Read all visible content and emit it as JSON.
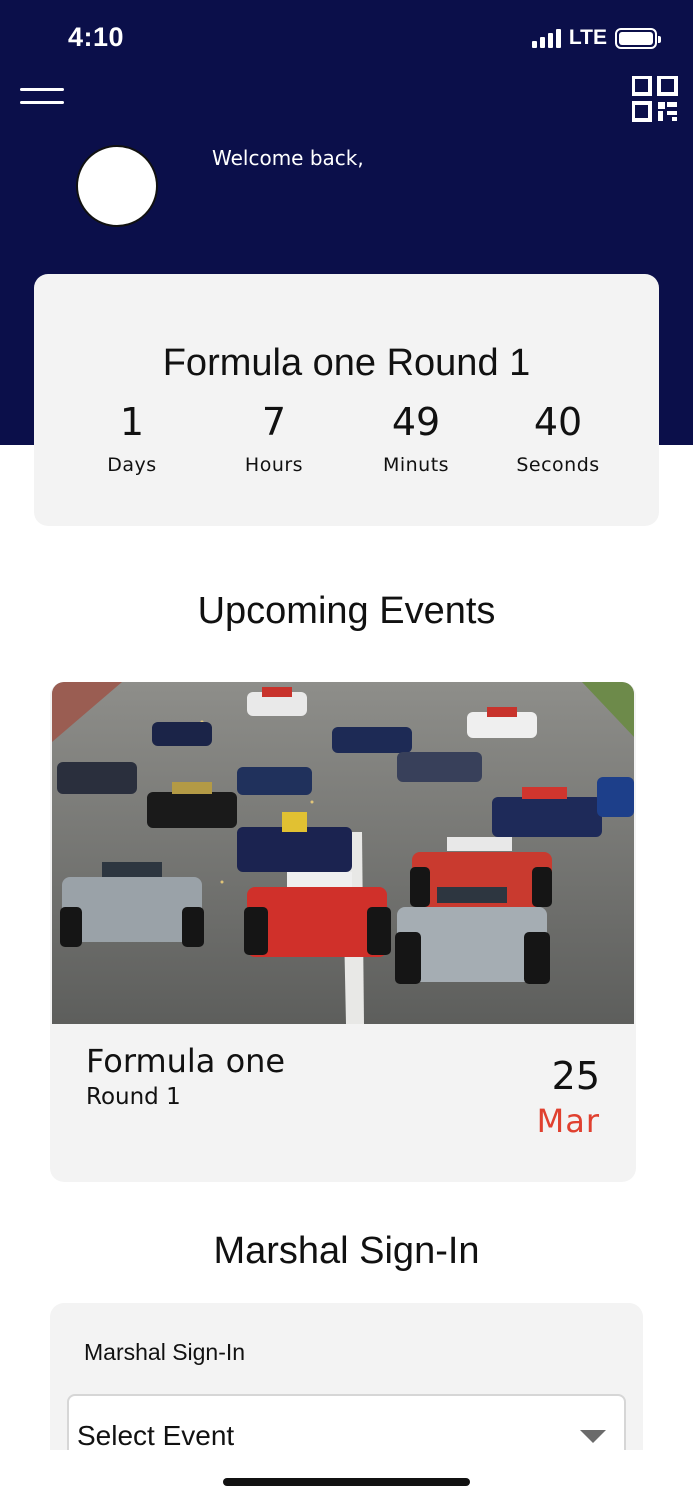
{
  "status_bar": {
    "time": "4:10",
    "network": "LTE",
    "signal_bars": 4,
    "battery_level": 1.0
  },
  "header": {
    "menu_icon": "hamburger-menu-icon",
    "qr_icon": "qr-code-icon",
    "welcome_text": "Welcome back,",
    "background_color": "#0b0f4a"
  },
  "countdown": {
    "title": "Formula one Round 1",
    "units": [
      {
        "value": "1",
        "label": "Days"
      },
      {
        "value": "7",
        "label": "Hours"
      },
      {
        "value": "49",
        "label": "Minuts"
      },
      {
        "value": "40",
        "label": "Seconds"
      }
    ]
  },
  "upcoming": {
    "title": "Upcoming Events",
    "events": [
      {
        "name": "Formula one",
        "round": "Round 1",
        "day": "25",
        "month": "Mar",
        "month_color": "#e0402f"
      }
    ]
  },
  "marshal": {
    "section_title": "Marshal Sign-In",
    "card_label": "Marshal Sign-In",
    "select_value": "Select Event",
    "select_icon": "dropdown-arrow-icon"
  }
}
